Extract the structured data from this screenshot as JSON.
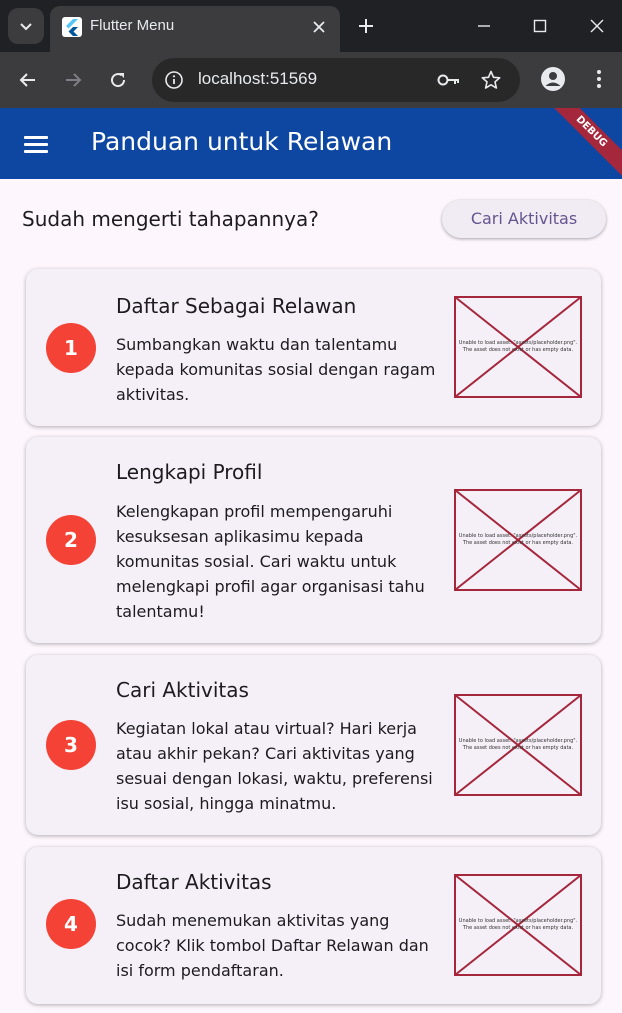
{
  "browser": {
    "tab_title": "Flutter Menu",
    "url": "localhost:51569"
  },
  "app": {
    "title": "Panduan untuk Relawan",
    "debug_label": "DEBUG",
    "question": "Sudah mengerti tahapannya?",
    "cta_label": "Cari Aktivitas",
    "placeholder_error": "Unable to load asset: \"assets/placeholder.png\". The asset does not exist or has empty data.",
    "steps": [
      {
        "number": "1",
        "title": "Daftar Sebagai Relawan",
        "description": "Sumbangkan waktu dan talentamu kepada komunitas sosial dengan ragam aktivitas."
      },
      {
        "number": "2",
        "title": "Lengkapi Profil",
        "description": "Kelengkapan profil mempengaruhi kesuksesan aplikasimu kepada komunitas sosial. Cari waktu untuk melengkapi profil agar organisasi tahu talentamu!"
      },
      {
        "number": "3",
        "title": "Cari Aktivitas",
        "description": "Kegiatan lokal atau virtual? Hari kerja atau akhir pekan? Cari aktivitas yang sesuai dengan lokasi, waktu, preferensi isu sosial, hingga minatmu."
      },
      {
        "number": "4",
        "title": "Daftar Aktivitas",
        "description": "Sudah menemukan aktivitas yang cocok? Klik tombol Daftar Relawan dan isi form pendaftaran."
      }
    ]
  },
  "colors": {
    "appbar": "#0d47a1",
    "step_badge": "#f44336",
    "card_bg": "#f5eff7",
    "page_bg": "#fdf7fd",
    "placeholder_stroke": "#a5273c",
    "button_text": "#65558f"
  }
}
